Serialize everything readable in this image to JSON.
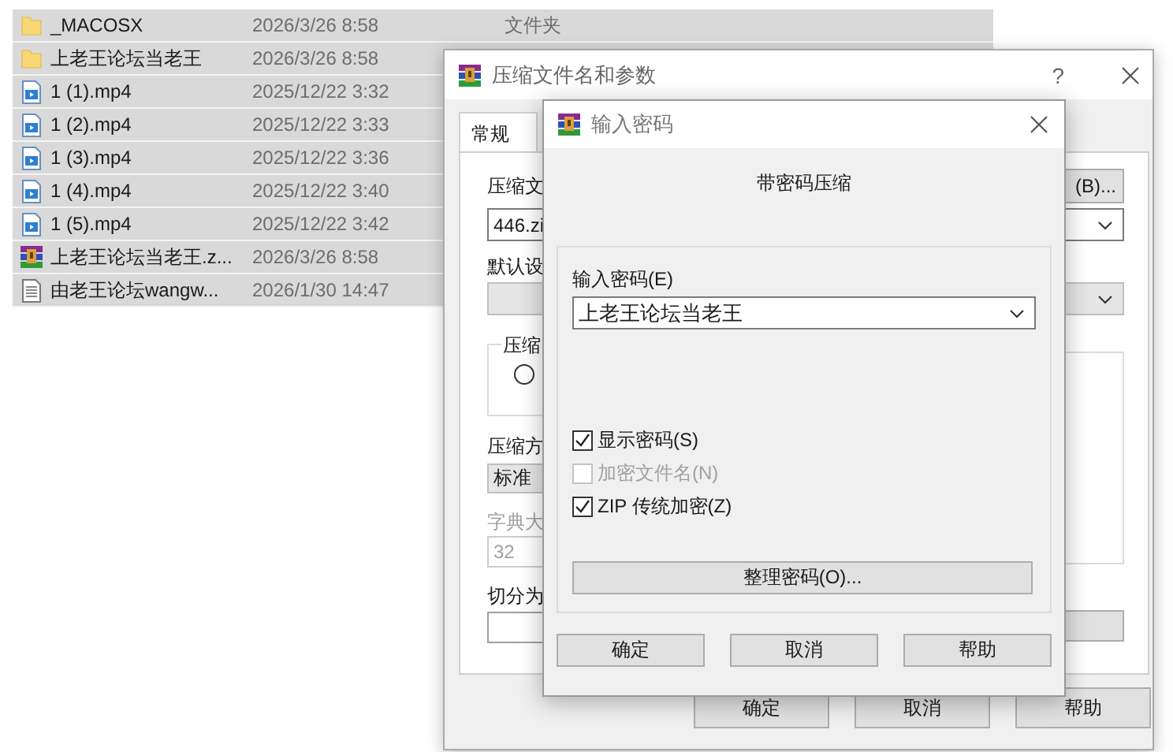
{
  "files": [
    {
      "kind": "folder",
      "name": "_MACOSX",
      "date": "2026/3/26 8:58",
      "type": "文件夹",
      "selected": true
    },
    {
      "kind": "folder",
      "name": "上老王论坛当老王",
      "date": "2026/3/26 8:58",
      "selected": true
    },
    {
      "kind": "video",
      "name": "1 (1).mp4",
      "date": "2025/12/22 3:32",
      "selected": true
    },
    {
      "kind": "video",
      "name": "1 (2).mp4",
      "date": "2025/12/22 3:33",
      "selected": true
    },
    {
      "kind": "video",
      "name": "1 (3).mp4",
      "date": "2025/12/22 3:36",
      "selected": true
    },
    {
      "kind": "video",
      "name": "1 (4).mp4",
      "date": "2025/12/22 3:40",
      "selected": true
    },
    {
      "kind": "video",
      "name": "1 (5).mp4",
      "date": "2025/12/22 3:42",
      "selected": true
    },
    {
      "kind": "archive",
      "name": "上老王论坛当老王.z...",
      "date": "2026/3/26 8:58",
      "selected": true
    },
    {
      "kind": "text",
      "name": "由老王论坛wangw...",
      "date": "2026/1/30 14:47",
      "selected": true
    }
  ],
  "archive_dialog": {
    "title": "压缩文件名和参数",
    "help": "?",
    "tabs": [
      {
        "label": "常规",
        "selected": true
      }
    ],
    "archive_name_label": "压缩文",
    "browse_button": "(B)...",
    "archive_name": "446.zi",
    "profile_label": "默认设",
    "format_group_label": "压缩",
    "format_radio": {
      "selected": false
    },
    "method_label": "压缩方",
    "method": "标准",
    "dictionary": {
      "label": "字典大",
      "value": "32",
      "disabled": true
    },
    "split_label": "切分为",
    "buttons": [
      "确定",
      "取消",
      "帮助"
    ]
  },
  "password_dialog": {
    "title": "输入密码",
    "heading": "带密码压缩",
    "password_label": "输入密码(E)",
    "password": "上老王论坛当老王",
    "options": [
      {
        "label": "显示密码(S)",
        "checked": true,
        "disabled": false
      },
      {
        "label": "加密文件名(N)",
        "checked": false,
        "disabled": true
      },
      {
        "label": "ZIP 传统加密(Z)",
        "checked": true,
        "disabled": false
      }
    ],
    "manage_button": "整理密码(O)...",
    "buttons": [
      "确定",
      "取消",
      "帮助"
    ]
  }
}
